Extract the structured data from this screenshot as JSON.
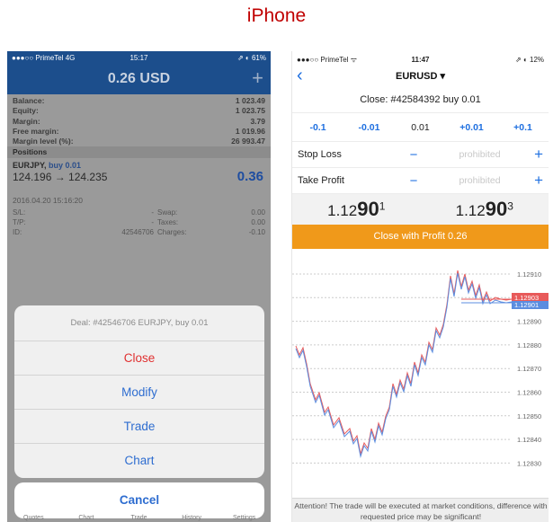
{
  "heading": "iPhone",
  "left": {
    "status": {
      "carrier": "●●●○○ PrimeTel 4G",
      "time": "15:17",
      "battery": "⇗ ◐ 61%"
    },
    "header_title": "0.26 USD",
    "add_icon": "+",
    "account": [
      {
        "label": "Balance:",
        "value": "1 023.49"
      },
      {
        "label": "Equity:",
        "value": "1 023.75"
      },
      {
        "label": "Margin:",
        "value": "3.79"
      },
      {
        "label": "Free margin:",
        "value": "1 019.96"
      },
      {
        "label": "Margin level (%):",
        "value": "26 993.47"
      }
    ],
    "positions_label": "Positions",
    "position": {
      "symbol": "EURJPY,",
      "side": "buy 0.01",
      "prices": "124.196 → 124.235",
      "profit": "0.36",
      "date": "2016.04.20 15:16:20",
      "details": [
        {
          "k1": "S/L:",
          "v1": "-",
          "k2": "Swap:",
          "v2": "0.00"
        },
        {
          "k1": "T/P:",
          "v1": "-",
          "k2": "Taxes:",
          "v2": "0.00"
        },
        {
          "k1": "ID:",
          "v1": "42546706",
          "k2": "Charges:",
          "v2": "-0.10"
        }
      ]
    },
    "sheet": {
      "deal": "Deal: #42546706 EURJPY, buy 0.01",
      "options": [
        "Close",
        "Modify",
        "Trade",
        "Chart"
      ],
      "cancel": "Cancel"
    },
    "tabs": [
      "Quotes",
      "Chart",
      "Trade",
      "History",
      "Settings"
    ]
  },
  "right": {
    "status": {
      "carrier": "●●●○○ PrimeTel ᯤ",
      "time": "11:47",
      "battery": "⇗ ◐ 12%"
    },
    "back": "‹",
    "symbol": "EURUSD ▾",
    "close_line": "Close: #42584392 buy 0.01",
    "steps": [
      "-0.1",
      "-0.01",
      "0.01",
      "+0.01",
      "+0.1"
    ],
    "stop_loss": {
      "label": "Stop Loss",
      "minus": "−",
      "value": "prohibited",
      "plus": "+"
    },
    "take_profit": {
      "label": "Take Profit",
      "minus": "−",
      "value": "prohibited",
      "plus": "+"
    },
    "bid": {
      "a": "1.12",
      "b": "90",
      "c": "1"
    },
    "ask": {
      "a": "1.12",
      "b": "90",
      "c": "3"
    },
    "close_button": "Close with Profit 0.26",
    "chart_axis": [
      "1.12910",
      "1.12900",
      "1.12890",
      "1.12880",
      "1.12870",
      "1.12860",
      "1.12850",
      "1.12840",
      "1.12830"
    ],
    "price_tag_top": "1.12903",
    "price_tag_bottom": "1.12901",
    "warning": "Attention! The trade will be executed at market conditions, difference with requested price may be significant!",
    "colors": {
      "accent": "#1e6fe0",
      "button": "#f0991a",
      "danger": "#e03030"
    }
  }
}
